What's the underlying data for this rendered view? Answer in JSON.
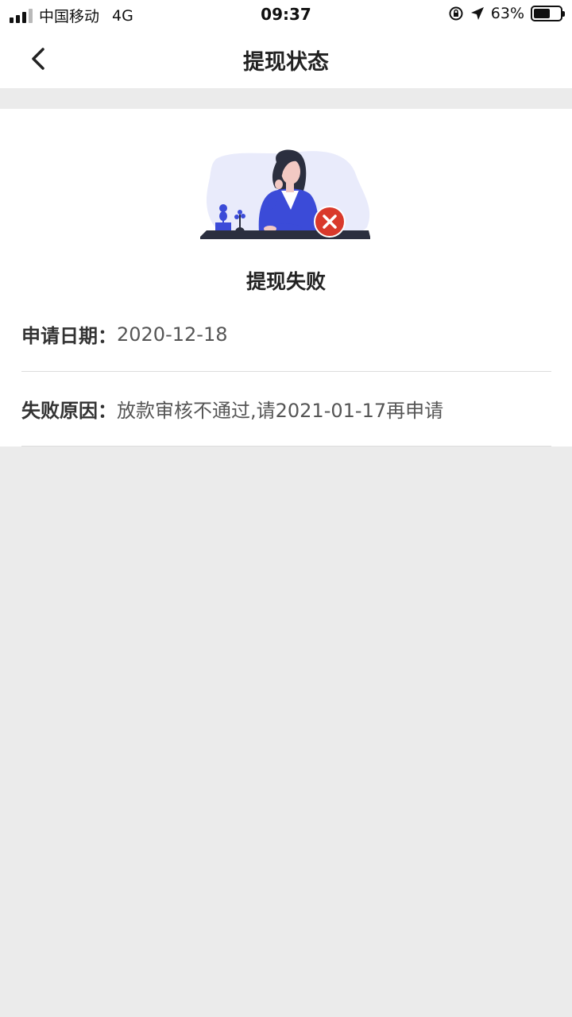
{
  "status_bar": {
    "carrier": "中国移动",
    "network": "4G",
    "time": "09:37",
    "battery_percent": "63%",
    "battery_level": 0.63
  },
  "nav": {
    "title": "提现状态",
    "back_icon": "chevron-left-icon"
  },
  "result": {
    "title": "提现失败",
    "illustration_icon": "woman-at-desk-failed-illustration",
    "status_icon": "close-circle-icon",
    "status_color": "#d9392b"
  },
  "details": [
    {
      "label": "申请日期：",
      "value": "2020-12-18"
    },
    {
      "label": "失败原因：",
      "value": "放款审核不通过,请2021-01-17再申请"
    }
  ]
}
